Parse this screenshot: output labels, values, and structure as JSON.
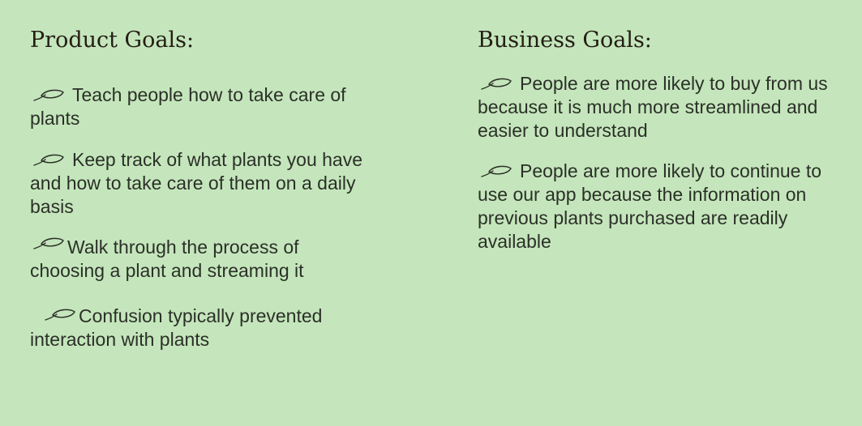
{
  "product": {
    "title": "Product Goals:",
    "items": [
      {
        "text": "Teach people how to take care of plants",
        "icon": "leaf-icon"
      },
      {
        "text": "Keep track of what plants you have and how to take care of them on a daily basis",
        "icon": "leaf-icon"
      },
      {
        "text": "Walk through the process of choosing a plant and streaming it",
        "icon": "leaf-icon"
      },
      {
        "text": "Confusion typically prevented interaction with plants",
        "icon": "leaf-icon"
      }
    ]
  },
  "business": {
    "title": "Business Goals:",
    "items": [
      {
        "text": "People are more likely to buy from us because it is much more streamlined and easier to understand",
        "icon": "leaf-icon"
      },
      {
        "text": "People are more likely to continue to use our app because the information on previous plants purchased are readily available",
        "icon": "leaf-icon"
      }
    ]
  },
  "colors": {
    "background": "#c5e6bc",
    "heading": "#241d15",
    "body_text": "#2b3028",
    "icon_stroke": "#2b3028"
  }
}
